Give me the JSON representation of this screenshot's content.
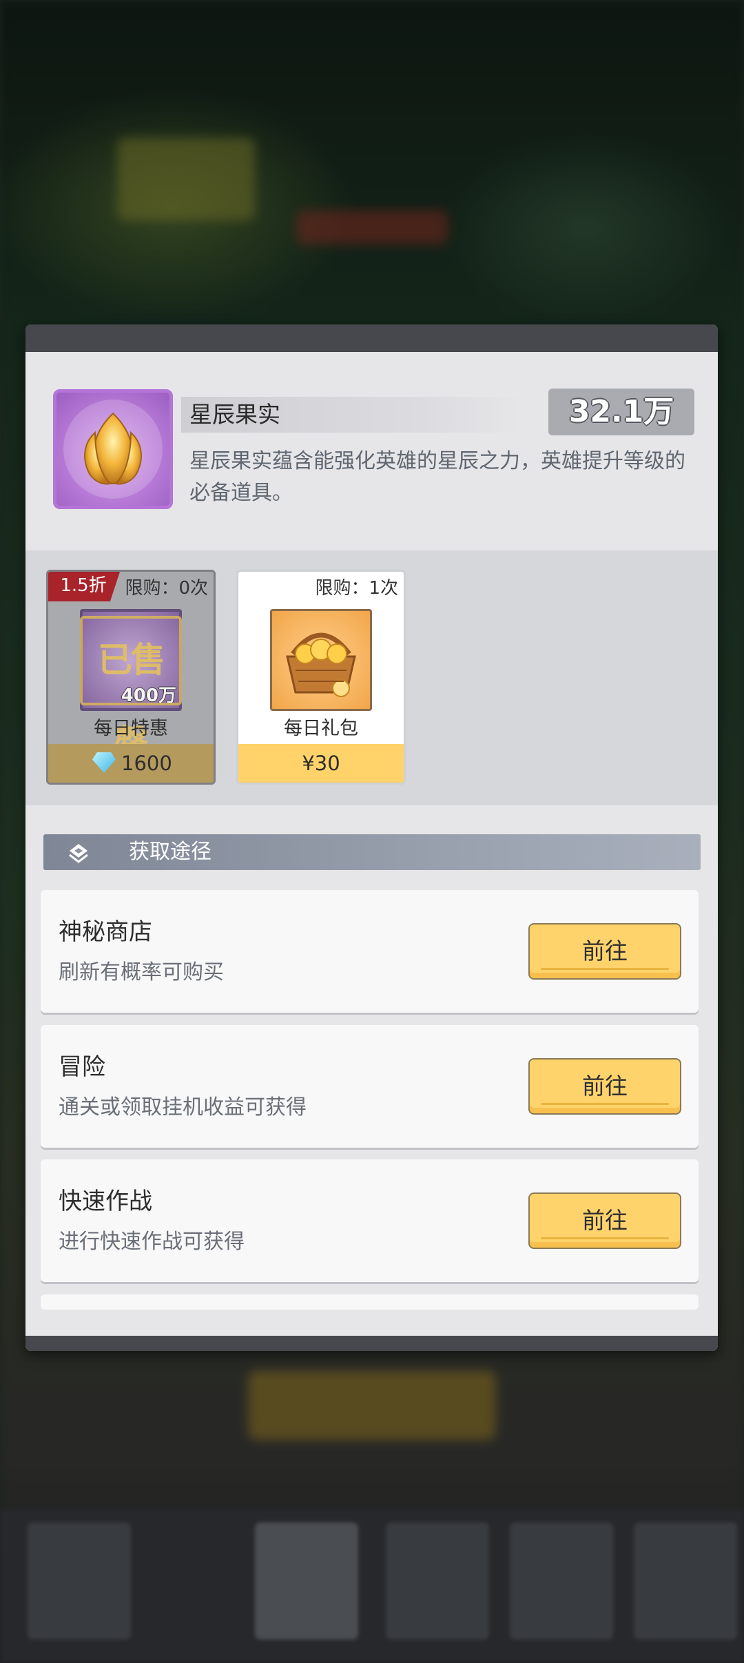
{
  "item": {
    "name": "星辰果实",
    "count": "32.1万",
    "description": "星辰果实蕴含能强化英雄的星辰之力，英雄提升等级的必备道具。",
    "icon": "golden-star-fruit-icon"
  },
  "offers": [
    {
      "discount": "1.5折",
      "limit": "限购：0次",
      "quantity": "400万",
      "stamp": "已售罄",
      "name": "每日特惠",
      "price": "1600",
      "price_icon": "diamond-icon"
    },
    {
      "limit": "限购：1次",
      "name": "每日礼包",
      "price": "¥30",
      "icon": "fruit-basket-icon"
    }
  ],
  "acquisition": {
    "title": "获取途径",
    "sources": [
      {
        "title": "神秘商店",
        "desc": "刷新有概率可购买",
        "button": "前往"
      },
      {
        "title": "冒险",
        "desc": "通关或领取挂机收益可获得",
        "button": "前往"
      },
      {
        "title": "快速作战",
        "desc": "进行快速作战可获得",
        "button": "前往"
      }
    ]
  },
  "colors": {
    "accent_yellow": "#ffd36c",
    "discount_red": "#a8232a",
    "item_purple": "#b474d8"
  }
}
